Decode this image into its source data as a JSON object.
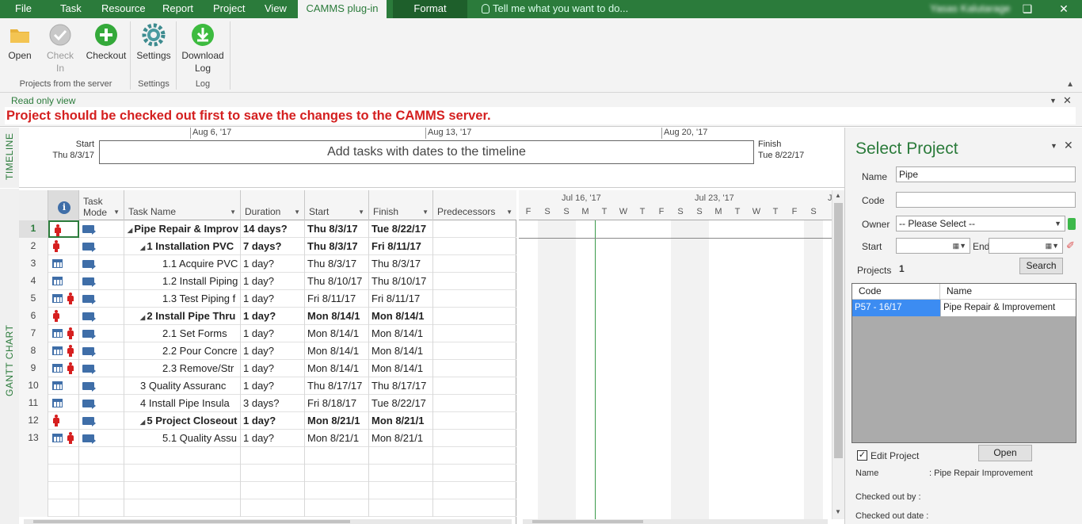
{
  "menubar": {
    "tabs": [
      "File",
      "Task",
      "Resource",
      "Report",
      "Project",
      "View",
      "CAMMS plug-in",
      "Format"
    ],
    "tell_me": "Tell me what you want to do...",
    "user": "Yasas Kalutarage"
  },
  "ribbon": {
    "open": "Open",
    "check_in_1": "Check",
    "check_in_2": "In",
    "checkout": "Checkout",
    "settings": "Settings",
    "download_1": "Download",
    "download_2": "Log",
    "group_projects": "Projects from the server",
    "group_settings": "Settings",
    "group_log": "Log"
  },
  "readonly": {
    "title": "Read only view",
    "message": "Project should be checked out first to save the changes to the CAMMS server."
  },
  "timeline": {
    "label": "TIMELINE",
    "dates": [
      "Aug 6, '17",
      "Aug 13, '17",
      "Aug 20, '17"
    ],
    "start_label": "Start",
    "start_date": "Thu 8/3/17",
    "finish_label": "Finish",
    "finish_date": "Tue 8/22/17",
    "placeholder": "Add tasks with dates to the timeline"
  },
  "gantt_label": "GANTT CHART",
  "grid": {
    "headers": {
      "task_mode_1": "Task",
      "task_mode_2": "Mode",
      "task_name": "Task Name",
      "duration": "Duration",
      "start": "Start",
      "finish": "Finish",
      "predecessors": "Predecessors"
    },
    "rows": [
      {
        "id": "1",
        "name": "Pipe Repair & Improv",
        "duration": "14 days?",
        "start": "Thu 8/3/17",
        "finish": "Tue 8/22/17",
        "bold": true,
        "indent": 0,
        "summary": true,
        "cal": false,
        "man": true
      },
      {
        "id": "2",
        "name": "1 Installation PVC",
        "duration": "7 days?",
        "start": "Thu 8/3/17",
        "finish": "Fri 8/11/17",
        "bold": true,
        "indent": 1,
        "summary": true,
        "cal": false,
        "man": true
      },
      {
        "id": "3",
        "name": "1.1 Acquire PVC",
        "duration": "1 day?",
        "start": "Thu 8/3/17",
        "finish": "Thu 8/3/17",
        "bold": false,
        "indent": 2,
        "summary": false,
        "cal": true,
        "man": false
      },
      {
        "id": "4",
        "name": "1.2 Install Piping",
        "duration": "1 day?",
        "start": "Thu 8/10/17",
        "finish": "Thu 8/10/17",
        "bold": false,
        "indent": 2,
        "summary": false,
        "cal": true,
        "man": false
      },
      {
        "id": "5",
        "name": "1.3 Test Piping f",
        "duration": "1 day?",
        "start": "Fri 8/11/17",
        "finish": "Fri 8/11/17",
        "bold": false,
        "indent": 2,
        "summary": false,
        "cal": true,
        "man": true
      },
      {
        "id": "6",
        "name": "2 Install Pipe Thru",
        "duration": "1 day?",
        "start": "Mon 8/14/1",
        "finish": "Mon 8/14/1",
        "bold": true,
        "indent": 1,
        "summary": true,
        "cal": false,
        "man": true
      },
      {
        "id": "7",
        "name": "2.1 Set Forms",
        "duration": "1 day?",
        "start": "Mon 8/14/1",
        "finish": "Mon 8/14/1",
        "bold": false,
        "indent": 2,
        "summary": false,
        "cal": true,
        "man": true
      },
      {
        "id": "8",
        "name": "2.2 Pour Concre",
        "duration": "1 day?",
        "start": "Mon 8/14/1",
        "finish": "Mon 8/14/1",
        "bold": false,
        "indent": 2,
        "summary": false,
        "cal": true,
        "man": true
      },
      {
        "id": "9",
        "name": "2.3 Remove/Str",
        "duration": "1 day?",
        "start": "Mon 8/14/1",
        "finish": "Mon 8/14/1",
        "bold": false,
        "indent": 2,
        "summary": false,
        "cal": true,
        "man": true
      },
      {
        "id": "10",
        "name": "3 Quality Assuranc",
        "duration": "1 day?",
        "start": "Thu 8/17/17",
        "finish": "Thu 8/17/17",
        "bold": false,
        "indent": 1,
        "summary": false,
        "cal": true,
        "man": false
      },
      {
        "id": "11",
        "name": "4 Install Pipe Insula",
        "duration": "3 days?",
        "start": "Fri 8/18/17",
        "finish": "Tue 8/22/17",
        "bold": false,
        "indent": 1,
        "summary": false,
        "cal": true,
        "man": false
      },
      {
        "id": "12",
        "name": "5 Project Closeout",
        "duration": "1 day?",
        "start": "Mon 8/21/1",
        "finish": "Mon 8/21/1",
        "bold": true,
        "indent": 1,
        "summary": true,
        "cal": false,
        "man": true
      },
      {
        "id": "13",
        "name": "5.1 Quality Assu",
        "duration": "1 day?",
        "start": "Mon 8/21/1",
        "finish": "Mon 8/21/1",
        "bold": false,
        "indent": 2,
        "summary": false,
        "cal": true,
        "man": true
      }
    ]
  },
  "chart": {
    "weeks": [
      "Jul 16, '17",
      "Jul 23, '17",
      "J"
    ],
    "days": [
      "F",
      "S",
      "S",
      "M",
      "T",
      "W",
      "T",
      "F",
      "S",
      "S",
      "M",
      "T",
      "W",
      "T",
      "F",
      "S"
    ]
  },
  "pane": {
    "title": "Select  Project",
    "name_label": "Name",
    "name_value": "Pipe",
    "code_label": "Code",
    "code_value": "",
    "owner_label": "Owner",
    "owner_value": "-- Please Select --",
    "start_label": "Start",
    "end_label": "End",
    "projects_label": "Projects",
    "projects_count": "1",
    "search": "Search",
    "col_code": "Code",
    "col_name": "Name",
    "result_code": "P57 - 16/17",
    "result_name": "Pipe Repair & Improvement",
    "edit_project": "Edit Project",
    "open": "Open",
    "d_name_label": "Name",
    "d_name_value": ":  Pipe Repair  Improvement",
    "d_checked_by": "Checked out by      :",
    "d_checked_date": "Checked out date :"
  }
}
